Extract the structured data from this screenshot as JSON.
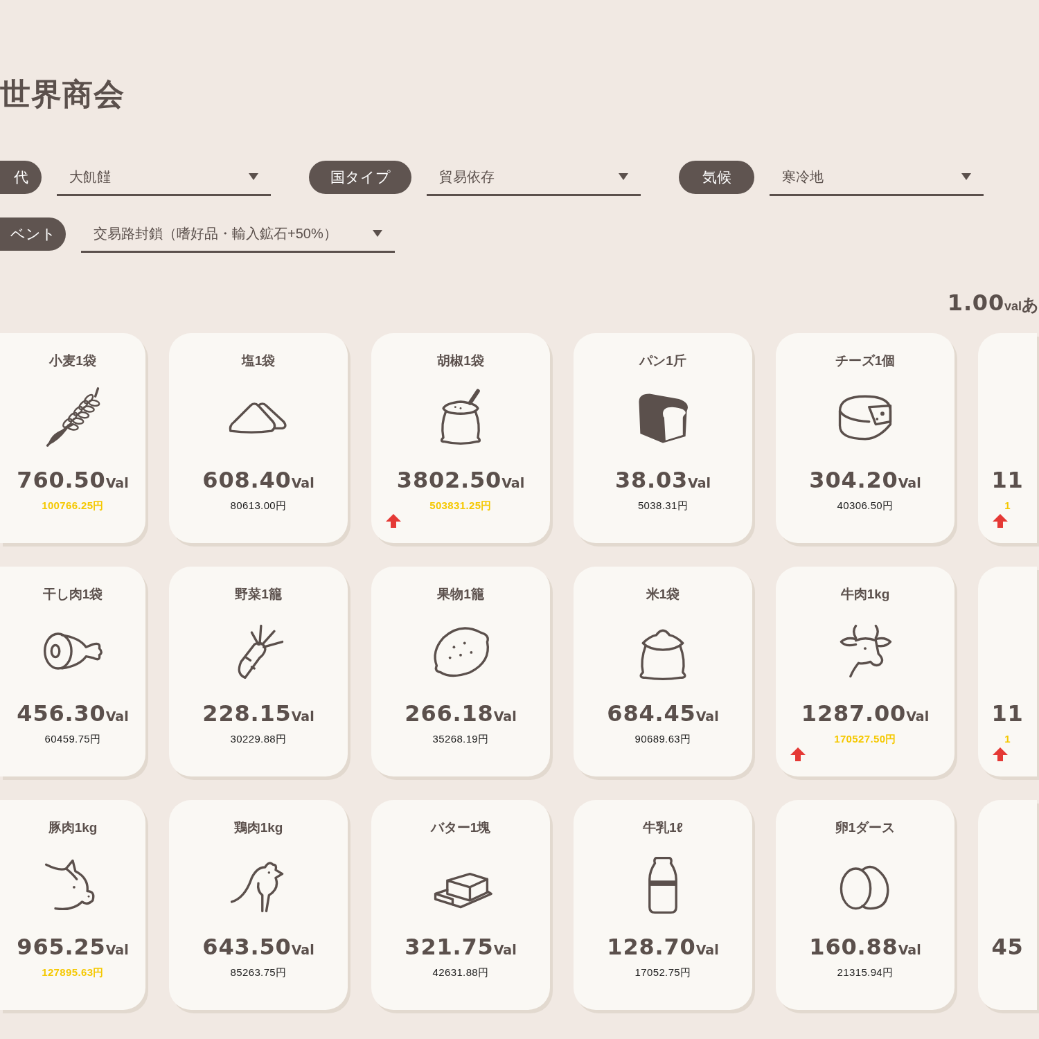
{
  "header": {
    "title": "世界商会"
  },
  "filters": [
    {
      "label": "代",
      "value": "大飢饉"
    },
    {
      "label": "国タイプ",
      "value": "貿易依存"
    },
    {
      "label": "気候",
      "value": "寒冷地"
    },
    {
      "label": "ベント",
      "value": "交易路封鎖（嗜好品・輸入鉱石+50%）"
    }
  ],
  "rate": {
    "amount": "1.00",
    "unit": "val",
    "suffix": "あ"
  },
  "items": [
    {
      "name": "小麦1袋",
      "price": "760.50",
      "unit": "Val",
      "yen": "100766.25円",
      "highlighted": true,
      "rising": false
    },
    {
      "name": "塩1袋",
      "price": "608.40",
      "unit": "Val",
      "yen": "80613.00円",
      "highlighted": false,
      "rising": false
    },
    {
      "name": "胡椒1袋",
      "price": "3802.50",
      "unit": "Val",
      "yen": "503831.25円",
      "highlighted": true,
      "rising": true
    },
    {
      "name": "パン1斤",
      "price": "38.03",
      "unit": "Val",
      "yen": "5038.31円",
      "highlighted": false,
      "rising": false
    },
    {
      "name": "チーズ1個",
      "price": "304.20",
      "unit": "Val",
      "yen": "40306.50円",
      "highlighted": false,
      "rising": false
    },
    {
      "price": "11",
      "yen": "1",
      "highlighted": true,
      "rising": true
    },
    {
      "name": "干し肉1袋",
      "price": "456.30",
      "unit": "Val",
      "yen": "60459.75円",
      "highlighted": false,
      "rising": false
    },
    {
      "name": "野菜1籠",
      "price": "228.15",
      "unit": "Val",
      "yen": "30229.88円",
      "highlighted": false,
      "rising": false
    },
    {
      "name": "果物1籠",
      "price": "266.18",
      "unit": "Val",
      "yen": "35268.19円",
      "highlighted": false,
      "rising": false
    },
    {
      "name": "米1袋",
      "price": "684.45",
      "unit": "Val",
      "yen": "90689.63円",
      "highlighted": false,
      "rising": false
    },
    {
      "name": "牛肉1kg",
      "price": "1287.00",
      "unit": "Val",
      "yen": "170527.50円",
      "highlighted": true,
      "rising": true
    },
    {
      "price": "11",
      "yen": "1",
      "highlighted": true,
      "rising": true
    },
    {
      "name": "豚肉1kg",
      "price": "965.25",
      "unit": "Val",
      "yen": "127895.63円",
      "highlighted": true,
      "rising": false
    },
    {
      "name": "鶏肉1kg",
      "price": "643.50",
      "unit": "Val",
      "yen": "85263.75円",
      "highlighted": false,
      "rising": false
    },
    {
      "name": "バター1塊",
      "price": "321.75",
      "unit": "Val",
      "yen": "42631.88円",
      "highlighted": false,
      "rising": false
    },
    {
      "name": "牛乳1ℓ",
      "price": "128.70",
      "unit": "Val",
      "yen": "17052.75円",
      "highlighted": false,
      "rising": false
    },
    {
      "name": "卵1ダース",
      "price": "160.88",
      "unit": "Val",
      "yen": "21315.94円",
      "highlighted": false,
      "rising": false
    },
    {
      "price": "45",
      "rising": false
    }
  ]
}
